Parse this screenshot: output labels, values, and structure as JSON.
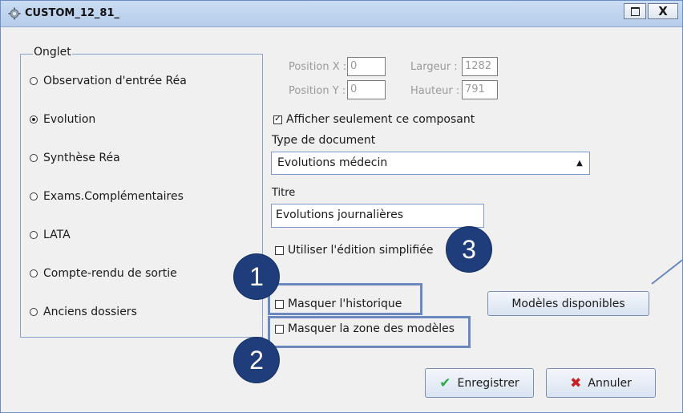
{
  "window": {
    "title": "CUSTOM_12_81_"
  },
  "titlebar_buttons": {
    "maximize_icon": "maximize-icon",
    "close_label": "X"
  },
  "tabs_group": {
    "legend": "Onglet",
    "items": [
      {
        "label": "Observation d'entrée Réa",
        "selected": false
      },
      {
        "label": "Evolution",
        "selected": true
      },
      {
        "label": "Synthèse Réa",
        "selected": false
      },
      {
        "label": "Exams.Complémentaires",
        "selected": false
      },
      {
        "label": "LATA",
        "selected": false
      },
      {
        "label": "Compte-rendu de sortie",
        "selected": false
      },
      {
        "label": "Anciens dossiers",
        "selected": false
      }
    ]
  },
  "geometry": {
    "position_x_label": "Position X :",
    "position_x_value": "0",
    "position_y_label": "Position Y :",
    "position_y_value": "0",
    "width_label": "Largeur :",
    "width_value": "1282",
    "height_label": "Hauteur :",
    "height_value": "791"
  },
  "options": {
    "show_only_component": {
      "label": "Afficher seulement ce composant",
      "checked": true
    },
    "simplified_edit": {
      "label": "Utiliser l'édition simplifiée",
      "checked": false
    },
    "hide_history": {
      "label": "Masquer l'historique",
      "checked": false
    },
    "hide_models_zone": {
      "label": "Masquer la zone des modèles",
      "checked": false
    }
  },
  "document_type": {
    "label": "Type de document",
    "value": "Evolutions médecin"
  },
  "title_field": {
    "label": "Titre",
    "value": "Evolutions journalières"
  },
  "buttons": {
    "models": "Modèles disponibles",
    "save": "Enregistrer",
    "cancel": "Annuler"
  },
  "annotations": {
    "badge_1": "1",
    "badge_2": "2",
    "badge_3": "3"
  },
  "colors": {
    "badge_fill": "#1f3d7a",
    "highlight": "#6b88bf",
    "save_icon": "#2ea84a",
    "cancel_icon": "#c82020"
  }
}
